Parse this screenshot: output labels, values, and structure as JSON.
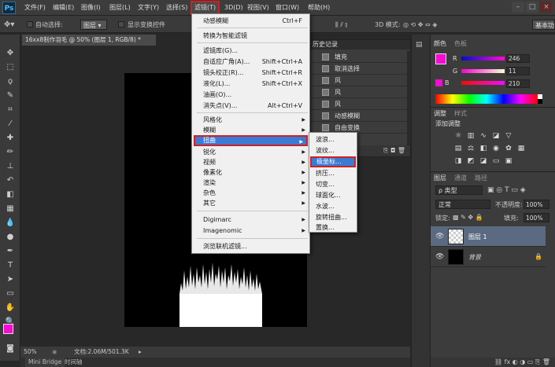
{
  "app": {
    "logo": "Ps"
  },
  "menubar": {
    "items": [
      "文件(F)",
      "编辑(E)",
      "图像(I)",
      "图层(L)",
      "文字(Y)",
      "选择(S)",
      "滤镜(T)",
      "3D(D)",
      "视图(V)",
      "窗口(W)",
      "帮助(H)"
    ]
  },
  "optionsbar": {
    "auto_select_label": "自动选择:",
    "auto_select_value": "图层",
    "show_transform_label": "显示变换控件",
    "mode_3d_label": "3D 模式:",
    "workspace": "基本功"
  },
  "document": {
    "tab_title": "16xx8制作羽毛 @ 50% (图层 1, RGB/8) *",
    "zoom": "50%",
    "doc_info": "文档:2.06M/501.3K"
  },
  "bottom_tabs": [
    "Mini Bridge",
    "时间轴"
  ],
  "filter_menu": {
    "groups": [
      [
        {
          "label": "动感模糊",
          "shortcut": "Ctrl+F"
        }
      ],
      [
        {
          "label": "转换为智能滤镜",
          "shortcut": ""
        }
      ],
      [
        {
          "label": "滤镜库(G)...",
          "shortcut": ""
        },
        {
          "label": "自适应广角(A)...",
          "shortcut": "Shift+Ctrl+A"
        },
        {
          "label": "镜头校正(R)...",
          "shortcut": "Shift+Ctrl+R"
        },
        {
          "label": "液化(L)...",
          "shortcut": "Shift+Ctrl+X"
        },
        {
          "label": "油画(O)...",
          "shortcut": ""
        },
        {
          "label": "消失点(V)...",
          "shortcut": "Alt+Ctrl+V"
        }
      ],
      [
        {
          "label": "风格化",
          "sub": true
        },
        {
          "label": "模糊",
          "sub": true
        },
        {
          "label": "扭曲",
          "sub": true,
          "highlight": true
        },
        {
          "label": "锐化",
          "sub": true
        },
        {
          "label": "视频",
          "sub": true
        },
        {
          "label": "像素化",
          "sub": true
        },
        {
          "label": "渲染",
          "sub": true
        },
        {
          "label": "杂色",
          "sub": true
        },
        {
          "label": "其它",
          "sub": true
        }
      ],
      [
        {
          "label": "Digimarc",
          "sub": true
        },
        {
          "label": "Imagenomic",
          "sub": true
        }
      ],
      [
        {
          "label": "浏览联机滤镜...",
          "shortcut": ""
        }
      ]
    ]
  },
  "distort_submenu": {
    "items": [
      "波浪...",
      "波纹...",
      "极坐标...",
      "挤压...",
      "切变...",
      "球面化...",
      "水波...",
      "旋转扭曲...",
      "置换..."
    ],
    "highlight_index": 2
  },
  "history_panel": {
    "title": "历史记录",
    "items": [
      "填充",
      "取消选择",
      "风",
      "风",
      "风",
      "动感模糊",
      "自由变换"
    ]
  },
  "color_panel": {
    "tabs": [
      "颜色",
      "色板"
    ],
    "r_label": "R",
    "r_value": "246",
    "g_label": "G",
    "g_value": "11",
    "b_label": "B",
    "b_value": "210",
    "foreground": "#f60bd2"
  },
  "adjust_panel": {
    "tabs": [
      "调整",
      "样式"
    ],
    "title": "添加调整"
  },
  "layers_panel": {
    "tabs": [
      "图层",
      "通道",
      "路径"
    ],
    "kind_label": "ρ 类型",
    "blend_mode": "正常",
    "opacity_label": "不透明度:",
    "opacity_value": "100%",
    "lock_label": "锁定:",
    "fill_label": "填充:",
    "fill_value": "100%",
    "layers": [
      {
        "name": "图层 1",
        "selected": true
      },
      {
        "name": "背景",
        "selected": false
      }
    ]
  }
}
